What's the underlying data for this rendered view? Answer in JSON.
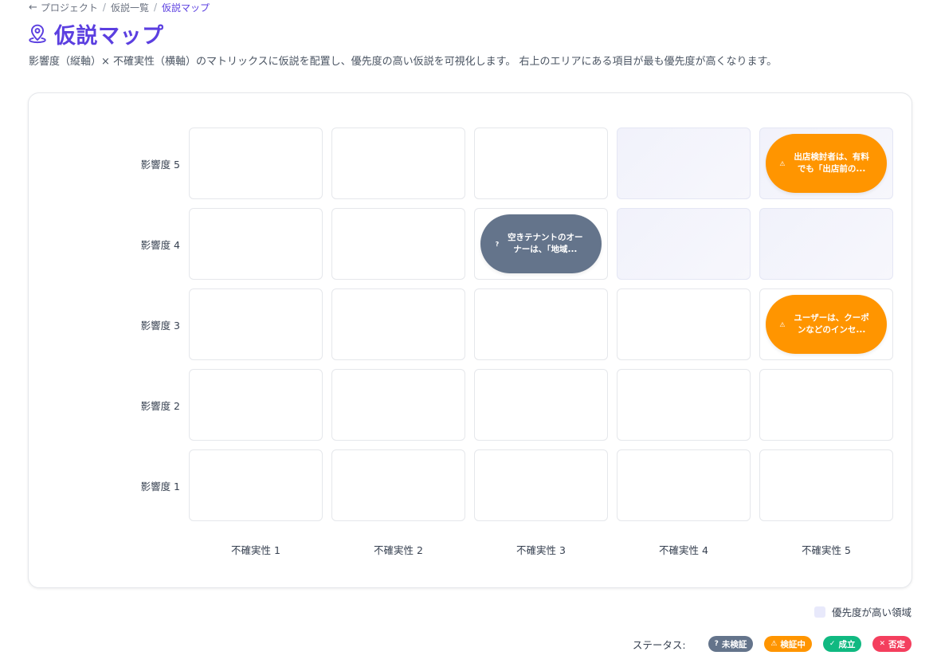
{
  "breadcrumb": {
    "back_icon": "arrow-left-icon",
    "items": [
      "プロジェクト",
      "仮説一覧",
      "仮説マップ"
    ],
    "separator": "/"
  },
  "page": {
    "title": "仮説マップ",
    "title_icon": "map-pin-icon",
    "description": "影響度（縦軸）× 不確実性（横軸）のマトリックスに仮説を配置し、優先度の高い仮説を可視化します。 右上のエリアにある項目が最も優先度が高くなります。"
  },
  "matrix": {
    "row_labels": [
      "影響度 5",
      "影響度 4",
      "影響度 3",
      "影響度 2",
      "影響度 1"
    ],
    "col_labels": [
      "不確実性 1",
      "不確実性 2",
      "不確実性 3",
      "不確実性 4",
      "不確実性 5"
    ],
    "priority_cells": [
      [
        5,
        4
      ],
      [
        5,
        5
      ],
      [
        4,
        4
      ],
      [
        4,
        5
      ]
    ],
    "hypotheses": [
      {
        "impact": 5,
        "uncertainty": 5,
        "status": "verifying",
        "icon": "warning-icon",
        "text": "出店検討者は、有料でも「出店前の..."
      },
      {
        "impact": 4,
        "uncertainty": 3,
        "status": "unverified",
        "icon": "question-icon",
        "text": "空きテナントのオーナーは、「地域..."
      },
      {
        "impact": 3,
        "uncertainty": 5,
        "status": "verifying",
        "icon": "warning-icon",
        "text": "ユーザーは、クーポンなどのインセ..."
      }
    ]
  },
  "legend": {
    "priority_label": "優先度が高い領域",
    "priority_color": "#e8e9fb",
    "status_title": "ステータス:",
    "statuses": [
      {
        "key": "unverified",
        "label": "未検証",
        "icon": "question-icon",
        "color": "#64748b"
      },
      {
        "key": "verifying",
        "label": "検証中",
        "icon": "warning-icon",
        "color": "#ff9500"
      },
      {
        "key": "established",
        "label": "成立",
        "icon": "check-circle-icon",
        "color": "#10b981"
      },
      {
        "key": "rejected",
        "label": "否定",
        "icon": "x-circle-icon",
        "color": "#f43f5e"
      }
    ]
  }
}
